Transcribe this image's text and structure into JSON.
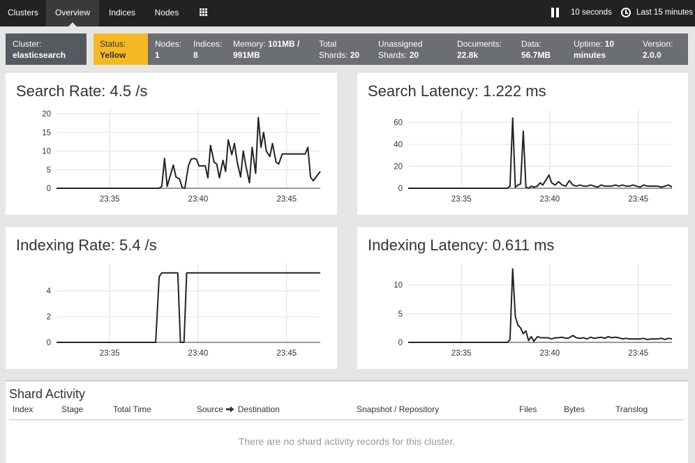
{
  "nav": {
    "tabs": [
      {
        "label": "Clusters",
        "active": false
      },
      {
        "label": "Overview",
        "active": true
      },
      {
        "label": "Indices",
        "active": false
      },
      {
        "label": "Nodes",
        "active": false
      }
    ],
    "apps_icon": "grid-icon",
    "refresh_interval": "10 seconds",
    "time_range": "Last 15 minutes"
  },
  "status": {
    "cluster_label": "Cluster:",
    "cluster_value": "elasticsearch",
    "status_label": "Status:",
    "status_value": "Yellow",
    "status_color": "#f5b923",
    "nodes_label": "Nodes:",
    "nodes_value": "1",
    "indices_label": "Indices:",
    "indices_value": "8",
    "memory_label": "Memory:",
    "memory_value": "101MB /",
    "memory_value2": "991MB",
    "total_shards_label": "Total",
    "total_shards_label2": "Shards:",
    "total_shards_value": "20",
    "unassigned_label": "Unassigned",
    "unassigned_label2": "Shards:",
    "unassigned_value": "20",
    "documents_label": "Documents:",
    "documents_value": "22.8k",
    "data_label": "Data:",
    "data_value": "56.7MB",
    "uptime_label": "Uptime:",
    "uptime_value": "10",
    "uptime_value2": "minutes",
    "version_label": "Version:",
    "version_value": "2.0.0"
  },
  "chart_data": [
    {
      "id": "search-rate",
      "type": "line",
      "title": "Search Rate: 4.5 /s",
      "xlabel": "",
      "ylabel": "",
      "x_ticks": [
        "23:35",
        "23:40",
        "23:45"
      ],
      "x_tick_pos": [
        3,
        8,
        13
      ],
      "xlim": [
        0,
        14.9
      ],
      "ylim": [
        0,
        20
      ],
      "y_ticks": [
        0,
        5,
        10,
        15,
        20
      ],
      "x": [
        0,
        5.8,
        5.95,
        6.1,
        6.25,
        6.4,
        6.6,
        6.75,
        6.95,
        7.1,
        7.25,
        7.45,
        7.6,
        7.75,
        7.9,
        8.05,
        8.25,
        8.4,
        8.55,
        8.7,
        8.9,
        9.05,
        9.2,
        9.4,
        9.55,
        9.7,
        9.9,
        10.05,
        10.2,
        10.4,
        10.55,
        10.7,
        10.9,
        11.05,
        11.25,
        11.4,
        11.55,
        11.7,
        11.85,
        12.05,
        12.2,
        12.4,
        12.55,
        12.75,
        12.9,
        13.05,
        13.2,
        13.4,
        13.55,
        13.7,
        13.9,
        14.05,
        14.2,
        14.35,
        14.5,
        14.9
      ],
      "y": [
        0,
        0,
        0.5,
        8,
        0.5,
        3,
        6.2,
        3,
        2.5,
        0.2,
        0,
        6,
        7.8,
        8,
        7.8,
        6,
        6,
        6,
        2.8,
        11.5,
        7,
        6.5,
        2.8,
        7.5,
        4.5,
        13,
        9,
        12,
        7.2,
        3,
        10,
        6,
        1.5,
        11,
        4,
        19,
        11,
        15,
        10,
        8.5,
        12,
        7,
        6.5,
        9.2,
        9.2,
        9.2,
        9.2,
        9.2,
        9.2,
        9.2,
        9.2,
        9.2,
        11,
        3,
        2,
        4.5
      ],
      "y_last": 4.5
    },
    {
      "id": "search-latency",
      "type": "line",
      "title": "Search Latency: 1.222 ms",
      "xlabel": "",
      "ylabel": "",
      "x_ticks": [
        "23:35",
        "23:40",
        "23:45"
      ],
      "x_tick_pos": [
        3,
        8,
        13
      ],
      "xlim": [
        0,
        14.9
      ],
      "ylim": [
        0,
        68
      ],
      "y_ticks": [
        0,
        20,
        40,
        60
      ],
      "x": [
        0,
        5.6,
        5.75,
        5.9,
        6.05,
        6.2,
        6.35,
        6.5,
        6.65,
        6.8,
        6.95,
        7.1,
        7.3,
        7.45,
        7.6,
        7.8,
        7.95,
        8.1,
        8.3,
        8.5,
        8.7,
        8.9,
        9.1,
        9.3,
        9.5,
        9.7,
        9.9,
        10.1,
        10.3,
        10.5,
        10.7,
        10.9,
        11.1,
        11.3,
        11.5,
        11.7,
        11.9,
        12.1,
        12.3,
        12.5,
        12.7,
        12.9,
        13.1,
        13.3,
        13.5,
        13.7,
        13.9,
        14.1,
        14.3,
        14.5,
        14.7,
        14.9
      ],
      "y": [
        0,
        0,
        2,
        64,
        1,
        3,
        4,
        52,
        1,
        0,
        2,
        1,
        2,
        5,
        3,
        8,
        12,
        5,
        3,
        6,
        3,
        2,
        7,
        3,
        2,
        3,
        2,
        2,
        3,
        2,
        1,
        3,
        2,
        2,
        2,
        3,
        2,
        3,
        2,
        2,
        3,
        2,
        1,
        3,
        2,
        2,
        2,
        2,
        1,
        2,
        3,
        1.2
      ]
    },
    {
      "id": "indexing-rate",
      "type": "line",
      "title": "Indexing Rate: 5.4 /s",
      "xlabel": "",
      "ylabel": "",
      "x_ticks": [
        "23:35",
        "23:40",
        "23:45"
      ],
      "x_tick_pos": [
        3,
        8,
        13
      ],
      "xlim": [
        0,
        14.9
      ],
      "ylim": [
        0,
        5.8
      ],
      "y_ticks": [
        0,
        2,
        4
      ],
      "x": [
        0,
        5.6,
        5.8,
        5.95,
        6.3,
        6.7,
        6.85,
        7.0,
        7.1,
        7.2,
        7.35,
        14.9
      ],
      "y": [
        0,
        0,
        5.1,
        5.4,
        5.4,
        5.4,
        5.4,
        0,
        0,
        0,
        5.4,
        5.4
      ]
    },
    {
      "id": "indexing-latency",
      "type": "line",
      "title": "Indexing Latency: 0.611 ms",
      "xlabel": "",
      "ylabel": "",
      "x_ticks": [
        "23:35",
        "23:40",
        "23:45"
      ],
      "x_tick_pos": [
        3,
        8,
        13
      ],
      "xlim": [
        0,
        14.9
      ],
      "ylim": [
        0,
        13
      ],
      "y_ticks": [
        0,
        5,
        10
      ],
      "x": [
        0,
        5.6,
        5.75,
        5.9,
        6.05,
        6.2,
        6.35,
        6.5,
        6.65,
        6.8,
        6.95,
        7.1,
        7.3,
        7.5,
        7.7,
        7.9,
        8.1,
        8.3,
        8.5,
        8.7,
        8.9,
        9.1,
        9.3,
        9.5,
        9.7,
        9.9,
        10.1,
        10.3,
        10.5,
        10.7,
        10.9,
        11.1,
        11.3,
        11.5,
        11.7,
        11.9,
        12.1,
        12.3,
        12.5,
        12.7,
        12.9,
        13.1,
        13.3,
        13.5,
        13.7,
        13.9,
        14.1,
        14.3,
        14.5,
        14.7,
        14.9
      ],
      "y": [
        0,
        0,
        0.5,
        12.8,
        4.5,
        3,
        2.5,
        1.5,
        2,
        0.3,
        1,
        0.2,
        1,
        0.8,
        0.8,
        0.8,
        0.6,
        0.8,
        0.8,
        0.9,
        0.7,
        0.8,
        1.2,
        0.8,
        0.7,
        0.8,
        0.6,
        0.9,
        0.7,
        0.8,
        0.9,
        0.7,
        1,
        0.8,
        0.9,
        0.8,
        0.6,
        0.7,
        0.6,
        0.6,
        0.6,
        0.6,
        0.7,
        0.5,
        0.6,
        0.6,
        0.6,
        0.7,
        0.5,
        0.7,
        0.6
      ]
    }
  ],
  "shard_activity": {
    "title": "Shard Activity",
    "columns": [
      "Index",
      "Stage",
      "Total Time",
      "Source",
      "Destination",
      "Snapshot / Repository",
      "Files",
      "Bytes",
      "Translog"
    ],
    "arrow_icon": "arrow-right-icon",
    "empty_message": "There are no shard activity records for this cluster."
  }
}
